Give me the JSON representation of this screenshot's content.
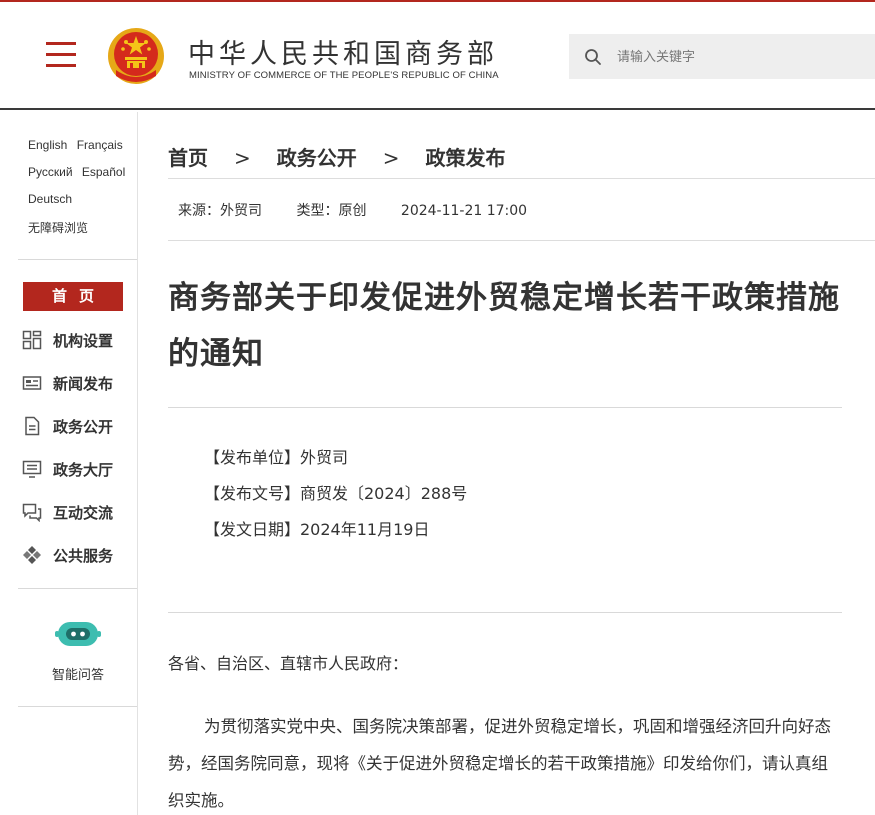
{
  "header": {
    "site_name": "中华人民共和国商务部",
    "site_name_en": "MINISTRY OF COMMERCE OF THE PEOPLE'S REPUBLIC OF CHINA",
    "search_placeholder": "请输入关键字",
    "accent_color": "#b3271e"
  },
  "sidebar": {
    "languages": [
      [
        "English",
        "Français"
      ],
      [
        "Русский",
        "Español"
      ],
      [
        "Deutsch"
      ],
      [
        "无障碍浏览"
      ]
    ],
    "home_label": "首页",
    "items": [
      {
        "label": "机构设置",
        "icon": "grid-icon"
      },
      {
        "label": "新闻发布",
        "icon": "news-icon"
      },
      {
        "label": "政务公开",
        "icon": "document-icon"
      },
      {
        "label": "政务大厅",
        "icon": "monitor-icon"
      },
      {
        "label": "互动交流",
        "icon": "chat-icon"
      },
      {
        "label": "公共服务",
        "icon": "service-icon"
      }
    ],
    "assistant_label": "智能问答"
  },
  "breadcrumb": [
    "首页",
    "政务公开",
    "政策发布"
  ],
  "breadcrumb_separator": ">",
  "meta": {
    "source": "来源：外贸司",
    "type": "类型：原创",
    "datetime": "2024-11-21 17:00"
  },
  "article": {
    "title": "商务部关于印发促进外贸稳定增长若干政策措施的通知",
    "issuer": "【发布单位】外贸司",
    "doc_number": "【发布文号】商贸发〔2024〕288号",
    "doc_date": "【发文日期】2024年11月19日",
    "salutation": "各省、自治区、直辖市人民政府：",
    "body": "为贯彻落实党中央、国务院决策部署，促进外贸稳定增长，巩固和增强经济回升向好态势，经国务院同意，现将《关于促进外贸稳定增长的若干政策措施》印发给你们，请认真组织实施。"
  }
}
